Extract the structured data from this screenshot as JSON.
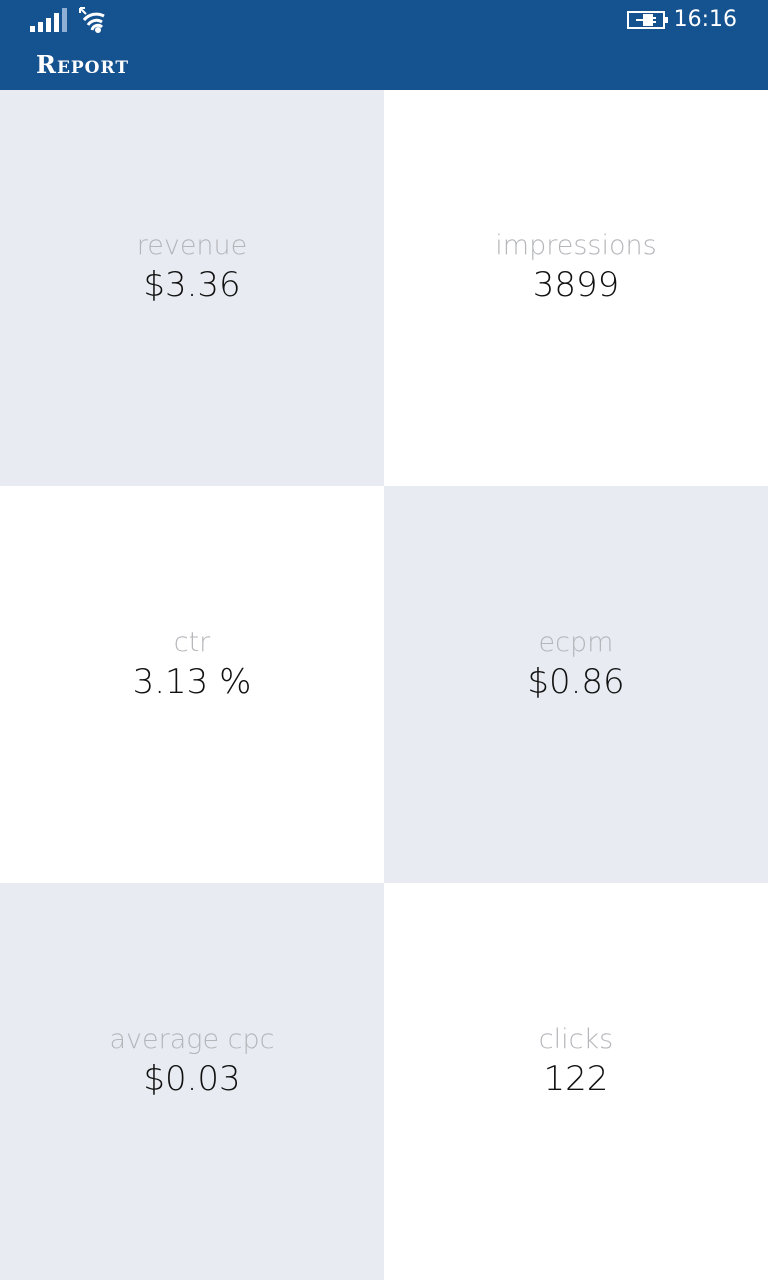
{
  "status_bar": {
    "time": "16:16",
    "signal_icon": "signal-strength-icon",
    "wifi_icon": "wifi-icon",
    "battery_icon": "battery-charging-icon"
  },
  "header": {
    "title": "Report",
    "background_color": "#155290"
  },
  "metrics": [
    {
      "label": "revenue",
      "value": "$3.36"
    },
    {
      "label": "impressions",
      "value": "3899"
    },
    {
      "label": "ctr",
      "value": "3.13 %"
    },
    {
      "label": "ecpm",
      "value": "$0.86"
    },
    {
      "label": "average cpc",
      "value": "$0.03"
    },
    {
      "label": "clicks",
      "value": "122"
    }
  ],
  "colors": {
    "accent": "#155290",
    "tile_shaded": "#e8ecf2",
    "tile_plain": "#ffffff",
    "label_text": "#b4b6ba",
    "value_text": "#111111"
  }
}
